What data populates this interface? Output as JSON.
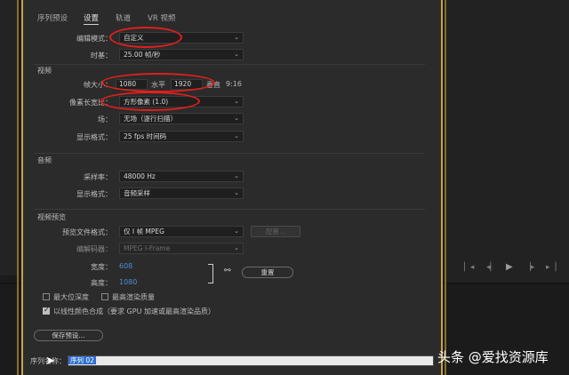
{
  "tabs": [
    {
      "label": "序列预设",
      "active": false
    },
    {
      "label": "设置",
      "active": true
    },
    {
      "label": "轨道",
      "active": false
    },
    {
      "label": "VR 视频",
      "active": false
    }
  ],
  "general": {
    "editing_mode_label": "编辑模式：",
    "editing_mode_value": "自定义",
    "timebase_label": "时基：",
    "timebase_value": "25.00  帧/秒"
  },
  "video": {
    "section_title": "视频",
    "frame_size_label": "帧大小：",
    "frame_w": "1080",
    "h_label": "水平",
    "frame_h": "1920",
    "v_label": "垂直",
    "aspect": "9:16",
    "pixel_ratio_label": "像素长宽比：",
    "pixel_ratio_value": "方形像素 (1.0)",
    "field_label": "场：",
    "field_value": "无场（逐行扫描）",
    "display_format_label": "显示格式：",
    "display_format_value": "25 fps 时间码"
  },
  "audio": {
    "section_title": "音频",
    "sample_rate_label": "采样率：",
    "sample_rate_value": "48000 Hz",
    "display_format_label": "显示格式：",
    "display_format_value": "音频采样"
  },
  "preview": {
    "section_title": "视频预览",
    "file_format_label": "预览文件格式：",
    "file_format_value": "仅 I 帧 MPEG",
    "config_button": "配置...",
    "codec_label": "编解码器：",
    "codec_value": "MPEG I-Frame",
    "width_label": "宽度：",
    "width_value": "608",
    "height_label": "高度：",
    "height_value": "1080",
    "reset_button": "重置",
    "max_bit_depth": "最大位深度",
    "max_render_quality": "最高渲染质量",
    "linear_color": "以线性颜色合成（要求 GPU 加速或最高渲染品质）"
  },
  "save_preset_button": "保存预设...",
  "sequence_name_label": "序列名称：",
  "sequence_name_value": "序列 02",
  "transport_icons": [
    "mark-in-icon",
    "mark-out-icon",
    "go-to-in-icon",
    "step-back-icon",
    "play-icon",
    "step-forward-icon",
    "go-to-out-icon"
  ],
  "watermark": "头条 @爱找资源库",
  "colors": {
    "accent_gold": "#c9a24a",
    "annotation_red": "#e0201c",
    "selection_blue": "#2f6fd0",
    "link_blue": "#4a8fd4"
  }
}
